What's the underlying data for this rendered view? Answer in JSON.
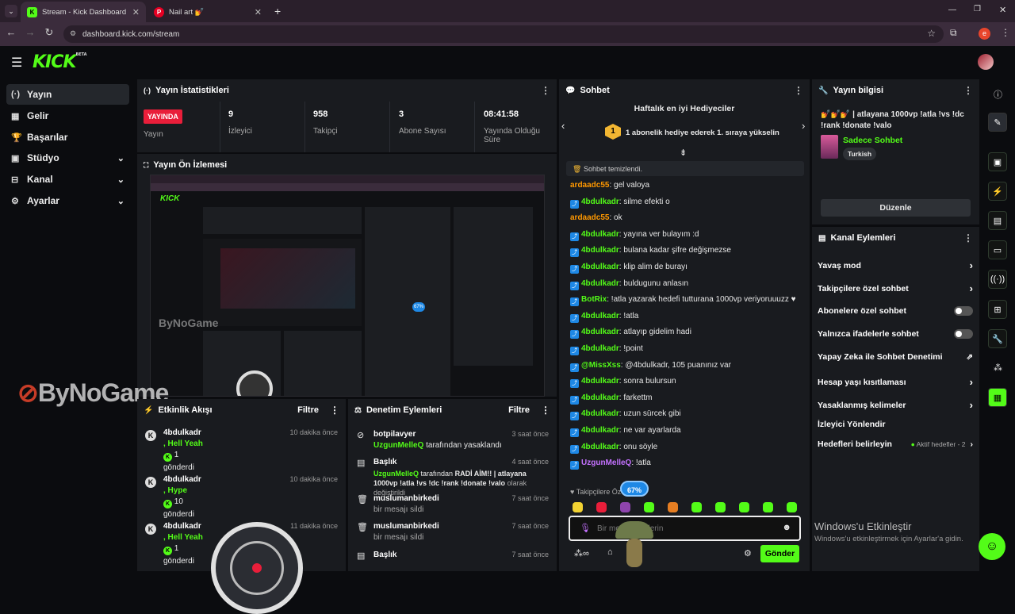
{
  "browser": {
    "tabs": [
      {
        "title": "Stream - Kick Dashboard",
        "icon": "K"
      },
      {
        "title": "Nail art 💅",
        "icon": "P"
      }
    ],
    "url": "dashboard.kick.com/stream",
    "profile_letter": "e"
  },
  "brand": {
    "logo": "KICK",
    "beta": "BETA",
    "accent": "#53fc18"
  },
  "sidebar": {
    "items": [
      {
        "label": "Yayın",
        "icon": "(·)"
      },
      {
        "label": "Gelir",
        "icon": "▦"
      },
      {
        "label": "Başarılar",
        "icon": "🏆"
      },
      {
        "label": "Stüdyo",
        "icon": "▣"
      },
      {
        "label": "Kanal",
        "icon": "⊟"
      },
      {
        "label": "Ayarlar",
        "icon": "⚙"
      }
    ]
  },
  "stats": {
    "title": "Yayın İstatistikleri",
    "live_badge": "YAYINDA",
    "items": [
      {
        "value": "",
        "label": "Yayın"
      },
      {
        "value": "9",
        "label": "İzleyici"
      },
      {
        "value": "958",
        "label": "Takipçi"
      },
      {
        "value": "3",
        "label": "Abone Sayısı"
      },
      {
        "value": "08:41:58",
        "label": "Yayında Olduğu Süre"
      }
    ]
  },
  "preview": {
    "title": "Yayın Ön İzlemesi",
    "watermark": "ByNoGame"
  },
  "activity": {
    "title": "Etkinlik Akışı",
    "filter": "Filtre",
    "items": [
      {
        "user": "4bdulkadr",
        "msg": ", Hell Yeah",
        "amount": "1",
        "sent": "gönderdi",
        "time": "10 dakika önce"
      },
      {
        "user": "4bdulkadr",
        "msg": ", Hype",
        "amount": "10",
        "sent": "gönderdi",
        "time": "10 dakika önce"
      },
      {
        "user": "4bdulkadr",
        "msg": ", Hell Yeah",
        "amount": "1",
        "sent": "gönderdi",
        "time": "11 dakika önce"
      }
    ]
  },
  "moderation": {
    "title": "Denetim Eylemleri",
    "filter": "Filtre",
    "items": [
      {
        "title": "botpilavyer",
        "actor": "UzgunMelleQ",
        "text": "tarafından yasaklandı",
        "time": "3 saat önce"
      },
      {
        "title": "Başlık",
        "actor": "UzgunMelleQ",
        "text": "tarafından",
        "bold": "RADİ AİM!! | atlayana 1000vp !atla !vs !dc !rank !donate !valo",
        "tail": "olarak değiştirildi",
        "time": "4 saat önce"
      },
      {
        "title": "muslumanbirkedi",
        "text": "bir mesajı sildi",
        "time": "7 saat önce"
      },
      {
        "title": "muslumanbirkedi",
        "text": "bir mesajı sildi",
        "time": "7 saat önce"
      },
      {
        "title": "Başlık",
        "text": "",
        "time": "7 saat önce"
      }
    ]
  },
  "chat": {
    "title": "Sohbet",
    "top_gifters": "Haftalık en iyi Hediyeciler",
    "gift_cta": "1 abonelik hediye ederek 1. sıraya yükselin",
    "rank": "1",
    "cleared": "Sohbet temizlendi.",
    "messages": [
      {
        "user": "ardaadc55",
        "text": "gel valoya",
        "color": "#ff9800",
        "badge": false
      },
      {
        "user": "4bdulkadr",
        "text": "silme efekti o",
        "color": "#53fc18",
        "badge": true
      },
      {
        "user": "ardaadc55",
        "text": "ok",
        "color": "#ff9800",
        "badge": false
      },
      {
        "user": "4bdulkadr",
        "text": "yayına ver bulayım :d",
        "color": "#53fc18",
        "badge": true
      },
      {
        "user": "4bdulkadr",
        "text": "bulana kadar şifre değişmezse",
        "color": "#53fc18",
        "badge": true
      },
      {
        "user": "4bdulkadr",
        "text": "klip alim de burayı",
        "color": "#53fc18",
        "badge": true
      },
      {
        "user": "4bdulkadr",
        "text": "buldugunu anlasın",
        "color": "#53fc18",
        "badge": true
      },
      {
        "user": "BotRix",
        "text": "!atla yazarak hedefi tutturana 1000vp veriyoruuuzz ♥",
        "color": "#53fc18",
        "badge": true
      },
      {
        "user": "4bdulkadr",
        "text": "!atla",
        "color": "#53fc18",
        "badge": true
      },
      {
        "user": "4bdulkadr",
        "text": "atlayıp gidelim hadi",
        "color": "#53fc18",
        "badge": true
      },
      {
        "user": "4bdulkadr",
        "text": "!point",
        "color": "#53fc18",
        "badge": true
      },
      {
        "user": "@MissXss",
        "text": "@4bdulkadr, 105 puanınız var",
        "color": "#53fc18",
        "badge": true
      },
      {
        "user": "4bdulkadr",
        "text": "sonra bulursun",
        "color": "#53fc18",
        "badge": true
      },
      {
        "user": "4bdulkadr",
        "text": "farkettm",
        "color": "#53fc18",
        "badge": true
      },
      {
        "user": "4bdulkadr",
        "text": "uzun sürcek gibi",
        "color": "#53fc18",
        "badge": true
      },
      {
        "user": "4bdulkadr",
        "text": "ne var ayarlarda",
        "color": "#53fc18",
        "badge": true
      },
      {
        "user": "4bdulkadr",
        "text": "onu söyle",
        "color": "#53fc18",
        "badge": true
      },
      {
        "user": "UzgunMelleQ",
        "text": "!atla",
        "color": "#c471ff",
        "badge": true
      }
    ],
    "followers_only": "Takipçilere Öz",
    "percent": "67%",
    "input_placeholder": "Bir mesaj gönderin",
    "send": "Gönder"
  },
  "stream_info": {
    "title": "Yayın bilgisi",
    "stream_title": "💅💅💅 | atlayana 1000vp !atla !vs !dc !rank !donate !valo",
    "category": "Sadece Sohbet",
    "tag": "Turkish",
    "edit": "Düzenle"
  },
  "channel_actions": {
    "title": "Kanal Eylemleri",
    "items": [
      {
        "label": "Yavaş mod",
        "control": "chevron"
      },
      {
        "label": "Takipçilere özel sohbet",
        "control": "chevron"
      },
      {
        "label": "Abonelere özel sohbet",
        "control": "toggle"
      },
      {
        "label": "Yalnızca ifadelerle sohbet",
        "control": "toggle"
      },
      {
        "label": "Yapay Zeka ile Sohbet Denetimi",
        "control": "external"
      },
      {
        "label": "Hesap yaşı kısıtlaması",
        "control": "chevron"
      },
      {
        "label": "Yasaklanmış kelimeler",
        "control": "chevron"
      },
      {
        "label": "İzleyici Yönlendir",
        "control": "none"
      },
      {
        "label": "Hedefleri belirleyin",
        "control": "chevron",
        "status": "Aktif hedefler - 2"
      }
    ]
  },
  "windows": {
    "title": "Windows'u Etkinleştir",
    "sub": "Windows'u etkinleştirmek için Ayarlar'a gidin."
  }
}
